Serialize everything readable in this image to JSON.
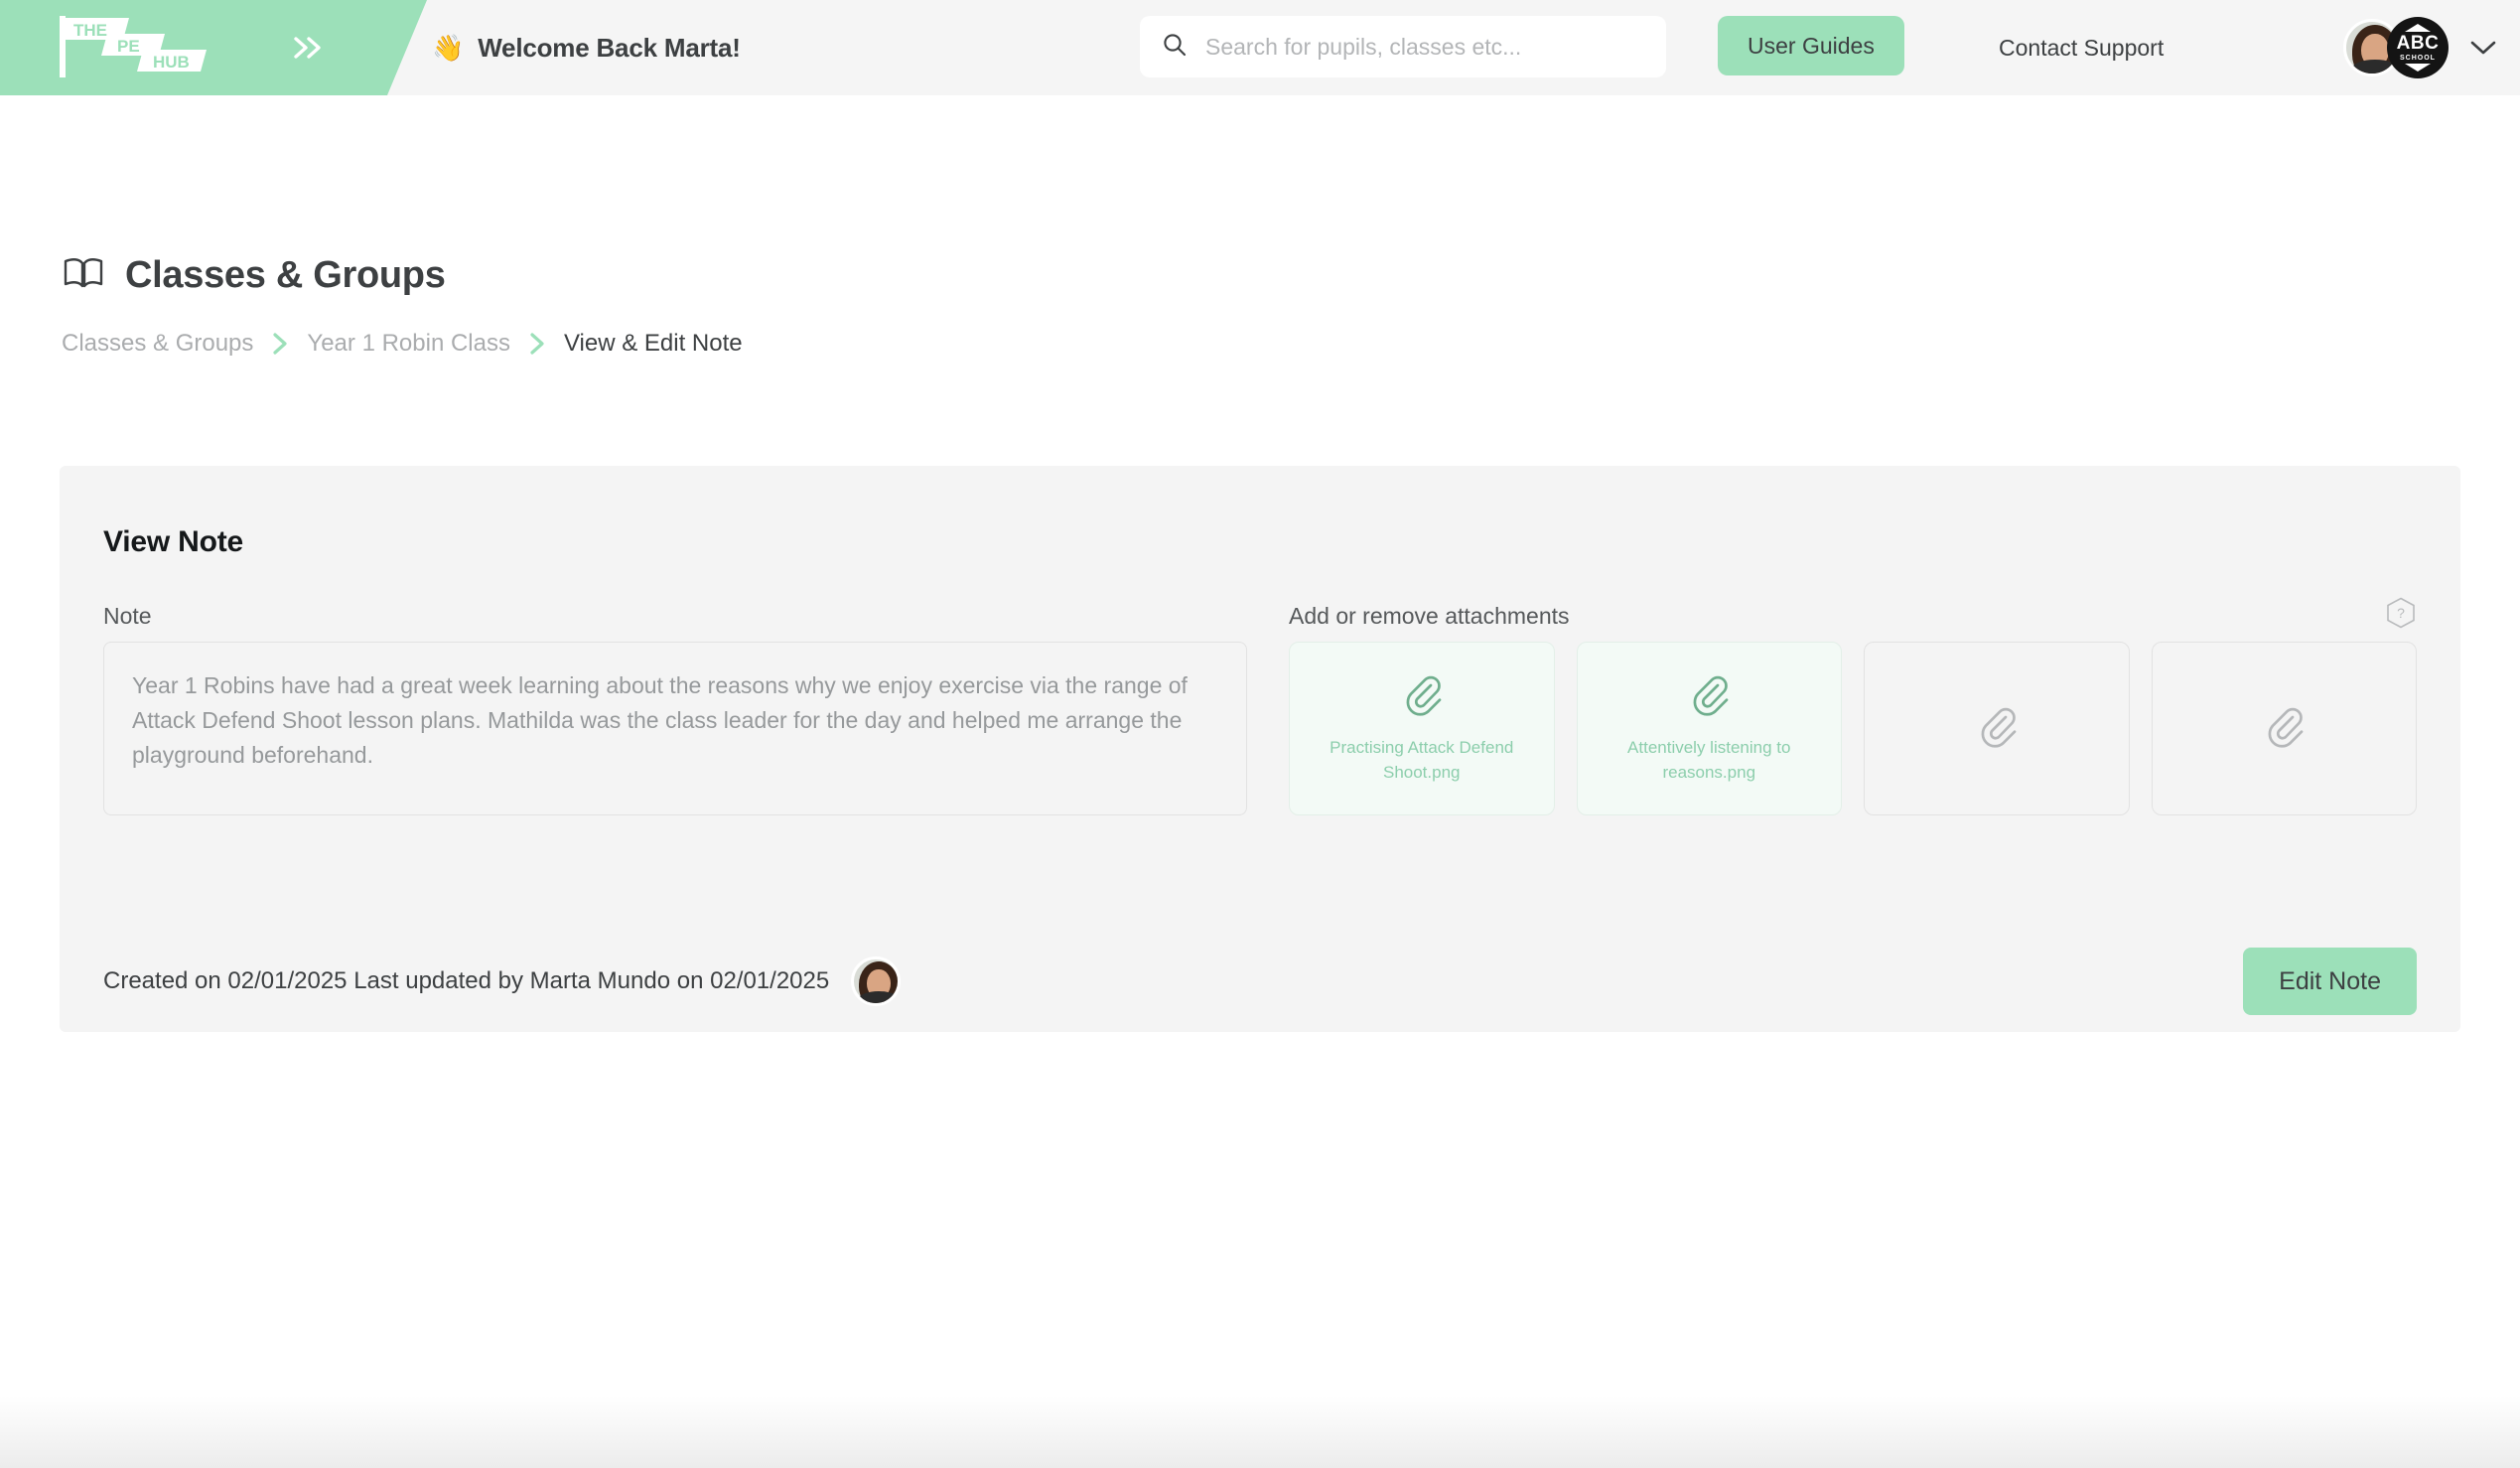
{
  "header": {
    "logo": {
      "icon": "pe-hub-flag-logo",
      "line1": "THE",
      "line2": "PE",
      "line3": "HUB"
    },
    "sidebar_toggle_icon": "double-chevron-right-icon",
    "welcome_wave": "👋",
    "welcome_text": "Welcome Back Marta!",
    "search": {
      "icon": "search-icon",
      "placeholder": "Search for pupils, classes etc...",
      "value": ""
    },
    "user_guides_label": "User Guides",
    "contact_support_label": "Contact Support",
    "account": {
      "avatar_icon": "user-avatar",
      "school_badge": {
        "icon": "abc-school-badge",
        "abc": "ABC",
        "school": "SCHOOL"
      },
      "chevron_icon": "chevron-down-icon"
    }
  },
  "page": {
    "title_icon": "open-book-icon",
    "title": "Classes & Groups",
    "breadcrumb": [
      {
        "label": "Classes & Groups",
        "active": false
      },
      {
        "label": "Year 1 Robin Class",
        "active": false
      },
      {
        "label": "View & Edit Note",
        "active": true
      }
    ]
  },
  "card": {
    "title": "View Note",
    "note_label": "Note",
    "note_text": "Year 1 Robins have had a great week learning about the reasons why we enjoy exercise via the range of Attack Defend Shoot lesson plans. Mathilda was the class leader for the day and helped me arrange the playground beforehand.",
    "attachments_label": "Add or remove attachments",
    "help_icon": "help-question-hexagon-icon",
    "attachments": [
      {
        "icon": "paperclip-icon",
        "name": "Practising Attack Defend Shoot.png",
        "filled": true
      },
      {
        "icon": "paperclip-icon",
        "name": "Attentively listening to reasons.png",
        "filled": true
      },
      {
        "icon": "paperclip-icon",
        "name": "",
        "filled": false
      },
      {
        "icon": "paperclip-icon",
        "name": "",
        "filled": false
      }
    ],
    "footer_meta": "Created on 02/01/2025 Last updated by Marta Mundo on 02/01/2025",
    "footer_avatar_icon": "user-avatar",
    "edit_button_label": "Edit Note"
  },
  "colors": {
    "accent_green": "#9ce0b9",
    "attachment_green": "#8cceac",
    "card_bg": "#f4f4f4",
    "header_bg": "#f5f5f5",
    "text_dark": "#3d4042",
    "text_muted": "#aaacae"
  }
}
